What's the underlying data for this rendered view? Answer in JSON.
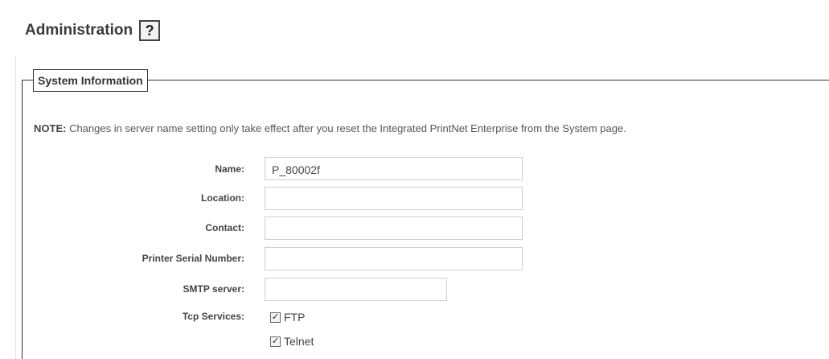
{
  "header": {
    "title": "Administration",
    "help_icon_glyph": "?"
  },
  "section": {
    "legend": "System Information",
    "note_label": "NOTE:",
    "note_text": " Changes in server name setting only take effect after you reset the Integrated PrintNet Enterprise from the System page."
  },
  "form": {
    "name": {
      "label": "Name:",
      "value": "P_80002f"
    },
    "location": {
      "label": "Location:",
      "value": ""
    },
    "contact": {
      "label": "Contact:",
      "value": ""
    },
    "serial": {
      "label": "Printer Serial Number:",
      "value": ""
    },
    "smtp": {
      "label": "SMTP server:",
      "value": ""
    },
    "tcp": {
      "label": "Tcp Services:",
      "services": [
        {
          "label": "FTP",
          "checked": true,
          "mark": "✓"
        },
        {
          "label": "Telnet",
          "checked": true,
          "mark": "✓"
        }
      ]
    }
  },
  "icons": {
    "help": "help-icon",
    "checkbox": "checkbox-checked-icon"
  }
}
